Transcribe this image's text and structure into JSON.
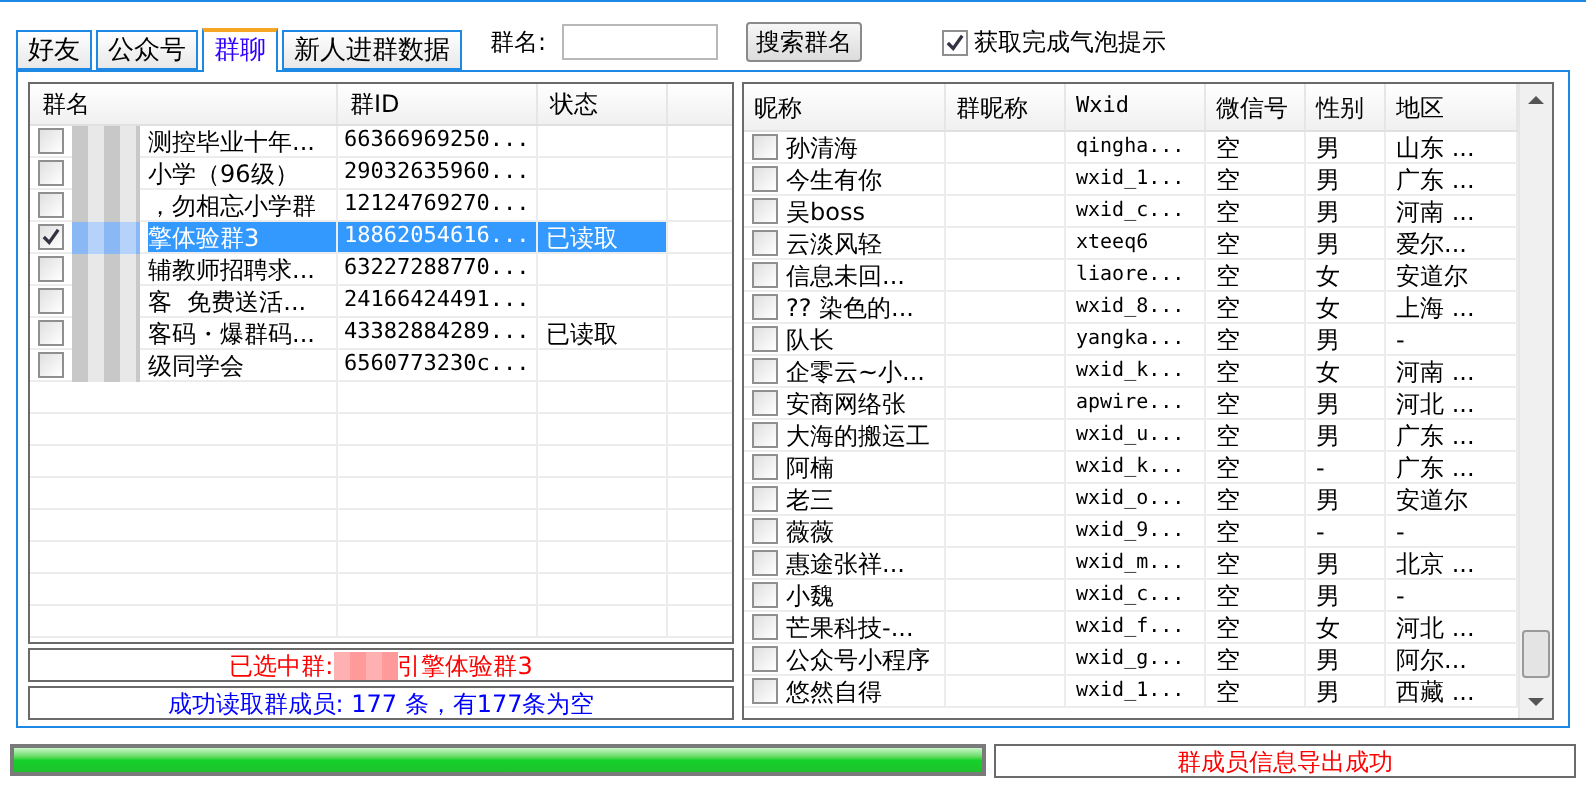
{
  "tabs": [
    {
      "label": "好友",
      "selected": false
    },
    {
      "label": "公众号",
      "selected": false
    },
    {
      "label": "群聊",
      "selected": true
    },
    {
      "label": "新人进群数据",
      "selected": false
    }
  ],
  "search": {
    "label": "群名:",
    "button": "搜索群名"
  },
  "bubble_option": {
    "label": "获取完成气泡提示",
    "checked": true
  },
  "group_table": {
    "columns": [
      "群名",
      "群ID",
      "状态"
    ],
    "rows": [
      {
        "name": "测控毕业十年...",
        "id": "66366969250...",
        "status": "",
        "checked": false,
        "selected": false
      },
      {
        "name": "小学（96级）",
        "id": "29032635960...",
        "status": "",
        "checked": false,
        "selected": false
      },
      {
        "name": "，勿相忘小学群",
        "id": "12124769270...",
        "status": "",
        "checked": false,
        "selected": false
      },
      {
        "name": "擎体验群3",
        "id": "18862054616...",
        "status": "已读取",
        "checked": true,
        "selected": true
      },
      {
        "name": "辅教师招聘求...",
        "id": "63227288770...",
        "status": "",
        "checked": false,
        "selected": false
      },
      {
        "name": "客  免费送活...",
        "id": "24166424491...",
        "status": "",
        "checked": false,
        "selected": false
      },
      {
        "name": "客码・爆群码...",
        "id": "43382884289...",
        "status": "已读取",
        "checked": false,
        "selected": false
      },
      {
        "name": "级同学会",
        "id": "6560773230c...",
        "status": "",
        "checked": false,
        "selected": false
      }
    ]
  },
  "selected_group": {
    "label": "已选中群:",
    "name": "引擎体验群3"
  },
  "read_status": "成功读取群成员: 177 条，有177条为空",
  "member_table": {
    "columns": [
      "昵称",
      "群昵称",
      "Wxid",
      "微信号",
      "性别",
      "地区"
    ],
    "rows": [
      {
        "nickname": "孙清海",
        "wxid": "qingha...",
        "wechat": "空",
        "gender": "男",
        "region": "山东 ...",
        "checked": false
      },
      {
        "nickname": "今生有你",
        "wxid": "wxid_1...",
        "wechat": "空",
        "gender": "男",
        "region": "广东 ...",
        "checked": false
      },
      {
        "nickname": "吴boss",
        "wxid": "wxid_c...",
        "wechat": "空",
        "gender": "男",
        "region": "河南 ...",
        "checked": false
      },
      {
        "nickname": "云淡风轻",
        "wxid": "xteeq6",
        "wechat": "空",
        "gender": "男",
        "region": "爱尔...",
        "checked": false
      },
      {
        "nickname": "信息未回...",
        "wxid": "liaore...",
        "wechat": "空",
        "gender": "女",
        "region": "安道尔",
        "checked": false
      },
      {
        "nickname": "?? 染色的...",
        "wxid": "wxid_8...",
        "wechat": "空",
        "gender": "女",
        "region": "上海 ...",
        "checked": false
      },
      {
        "nickname": "队长",
        "wxid": "yangka...",
        "wechat": "空",
        "gender": "男",
        "region": "-",
        "checked": false
      },
      {
        "nickname": "企零云~小...",
        "wxid": "wxid_k...",
        "wechat": "空",
        "gender": "女",
        "region": "河南 ...",
        "checked": false
      },
      {
        "nickname": "安商网络张",
        "wxid": "apwire...",
        "wechat": "空",
        "gender": "男",
        "region": "河北 ...",
        "checked": false
      },
      {
        "nickname": "大海的搬运工",
        "wxid": "wxid_u...",
        "wechat": "空",
        "gender": "男",
        "region": "广东 ...",
        "checked": false
      },
      {
        "nickname": "阿楠",
        "wxid": "wxid_k...",
        "wechat": "空",
        "gender": "-",
        "region": "广东 ...",
        "checked": false
      },
      {
        "nickname": "老三",
        "wxid": "wxid_o...",
        "wechat": "空",
        "gender": "男",
        "region": "安道尔",
        "checked": false
      },
      {
        "nickname": "薇薇",
        "wxid": "wxid_9...",
        "wechat": "空",
        "gender": "-",
        "region": "-",
        "checked": false
      },
      {
        "nickname": "惠途张祥...",
        "wxid": "wxid_m...",
        "wechat": "空",
        "gender": "男",
        "region": "北京 ...",
        "checked": false
      },
      {
        "nickname": "小魏",
        "wxid": "wxid_c...",
        "wechat": "空",
        "gender": "男",
        "region": "-",
        "checked": false
      },
      {
        "nickname": "芒果科技-...",
        "wxid": "wxid_f...",
        "wechat": "空",
        "gender": "女",
        "region": "河北 ...",
        "checked": false
      },
      {
        "nickname": "公众号小程序",
        "wxid": "wxid_g...",
        "wechat": "空",
        "gender": "男",
        "region": "阿尔...",
        "checked": false
      },
      {
        "nickname": "悠然自得",
        "wxid": "wxid_1...",
        "wechat": "空",
        "gender": "男",
        "region": "西藏 ...",
        "checked": false
      }
    ]
  },
  "progress": {
    "level": 1.0
  },
  "export_status": "群成员信息导出成功"
}
